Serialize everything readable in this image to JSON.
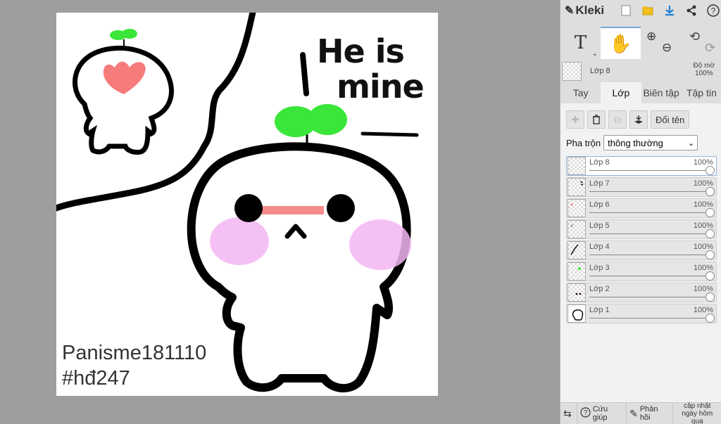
{
  "app": {
    "name": "Kleki"
  },
  "topbar": {
    "icons": [
      "new-image-icon",
      "folder-icon",
      "download-icon",
      "share-icon",
      "help-icon"
    ]
  },
  "tools": {
    "text_glyph": "T",
    "hand_glyph": "✋",
    "zoom_in": "⊕",
    "zoom_out": "⊖",
    "undo": "⟲",
    "redo": "⟳"
  },
  "current_layer": {
    "name": "Lớp 8",
    "opacity_label": "Độ mờ",
    "opacity_value": "100%"
  },
  "tabs": [
    {
      "label": "Tay",
      "active": false
    },
    {
      "label": "Lớp",
      "active": true
    },
    {
      "label": "Biên tập",
      "active": false
    },
    {
      "label": "Tập tin",
      "active": false
    }
  ],
  "layer_buttons": {
    "rename_label": "Đổi tên"
  },
  "blend": {
    "label": "Pha trộn",
    "value": "thông thường"
  },
  "layers": [
    {
      "name": "Lớp 8",
      "opacity": "100%",
      "selected": true
    },
    {
      "name": "Lớp 7",
      "opacity": "100%",
      "selected": false
    },
    {
      "name": "Lớp 6",
      "opacity": "100%",
      "selected": false
    },
    {
      "name": "Lớp 5",
      "opacity": "100%",
      "selected": false
    },
    {
      "name": "Lớp 4",
      "opacity": "100%",
      "selected": false
    },
    {
      "name": "Lớp 3",
      "opacity": "100%",
      "selected": false
    },
    {
      "name": "Lớp 2",
      "opacity": "100%",
      "selected": false
    },
    {
      "name": "Lớp 1",
      "opacity": "100%",
      "selected": false
    }
  ],
  "bottombar": {
    "help_label": "Cứu giúp",
    "feedback_label": "Phản hồi",
    "update_line1": "cập nhật",
    "update_line2": "ngày hôm qua"
  },
  "canvas": {
    "text_he_is": "He is",
    "text_mine": "mine",
    "signature_line1": "Panisme181110",
    "signature_line2": "#hđ247"
  },
  "colors": {
    "accent": "#1e7fd8",
    "sprout": "#39e639",
    "heart": "#f67b7b",
    "blush": "#f3b6f3",
    "nose_bar": "#f58c8c"
  }
}
